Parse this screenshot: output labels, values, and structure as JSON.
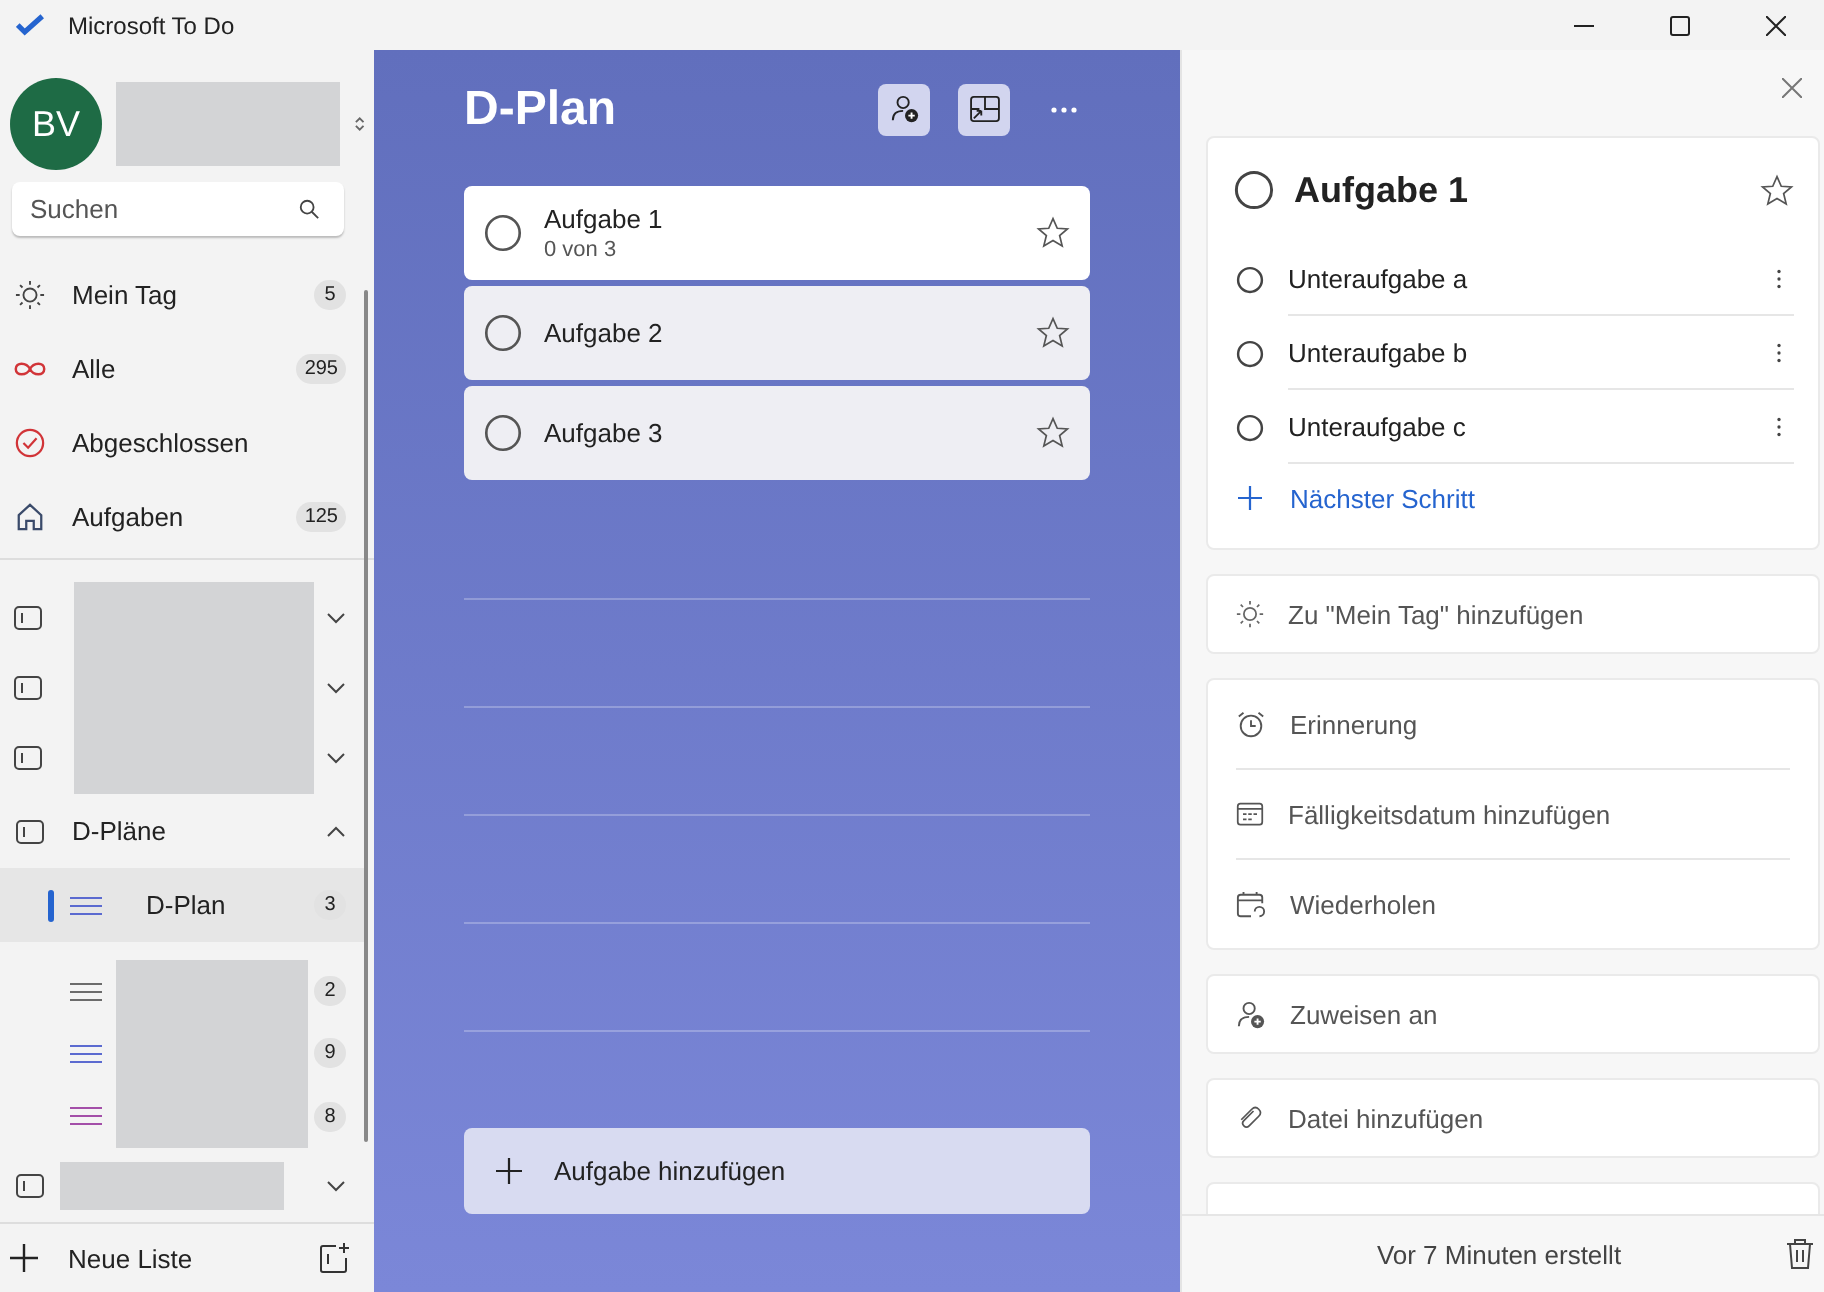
{
  "window": {
    "title": "Microsoft To Do"
  },
  "sidebar": {
    "avatar": "BV",
    "search": {
      "placeholder": "Suchen"
    },
    "smart_lists": [
      {
        "kind": "sun",
        "label": "Mein Tag",
        "count": "5"
      },
      {
        "kind": "infinity",
        "label": "Alle",
        "count": "295"
      },
      {
        "kind": "check",
        "label": "Abgeschlossen"
      },
      {
        "kind": "home",
        "label": "Aufgaben",
        "count": "125"
      }
    ],
    "collapsed_groups": [
      {
        "expanded": false
      },
      {
        "expanded": false
      },
      {
        "expanded": false
      }
    ],
    "open_group": {
      "name": "D-Pläne",
      "expanded": true,
      "lists": [
        {
          "name": "D-Plan",
          "count": "3",
          "selected": true,
          "color": "#5b6ad0"
        },
        {
          "count": "2",
          "selected": false,
          "color": "#6b6b6b"
        },
        {
          "count": "9",
          "selected": false,
          "color": "#5b6ad0"
        },
        {
          "count": "8",
          "selected": false,
          "color": "#a34ea8"
        }
      ]
    },
    "last_group": {
      "expanded": false
    },
    "new_list": "Neue Liste"
  },
  "list": {
    "title": "D-Plan",
    "tasks": [
      {
        "title": "Aufgabe 1",
        "subtitle": "0 von 3",
        "selected": true,
        "completed": false,
        "important": false
      },
      {
        "title": "Aufgabe 2",
        "selected": false,
        "completed": false,
        "important": false
      },
      {
        "title": "Aufgabe 3",
        "selected": false,
        "completed": false,
        "important": false
      }
    ],
    "add_task": "Aufgabe hinzufügen"
  },
  "detail": {
    "title": "Aufgabe 1",
    "completed": false,
    "important": false,
    "steps": [
      {
        "title": "Unteraufgabe a",
        "completed": false
      },
      {
        "title": "Unteraufgabe b",
        "completed": false
      },
      {
        "title": "Unteraufgabe c",
        "completed": false
      }
    ],
    "next_step": "Nächster Schritt",
    "my_day": "Zu \"Mein Tag\" hinzufügen",
    "dates": [
      {
        "kind": "alarm",
        "label": "Erinnerung"
      },
      {
        "kind": "calendar",
        "label": "Fälligkeitsdatum hinzufügen"
      },
      {
        "kind": "repeat",
        "label": "Wiederholen"
      }
    ],
    "assign": "Zuweisen an",
    "attach": "Datei hinzufügen",
    "created": "Vor 7 Minuten erstellt"
  }
}
